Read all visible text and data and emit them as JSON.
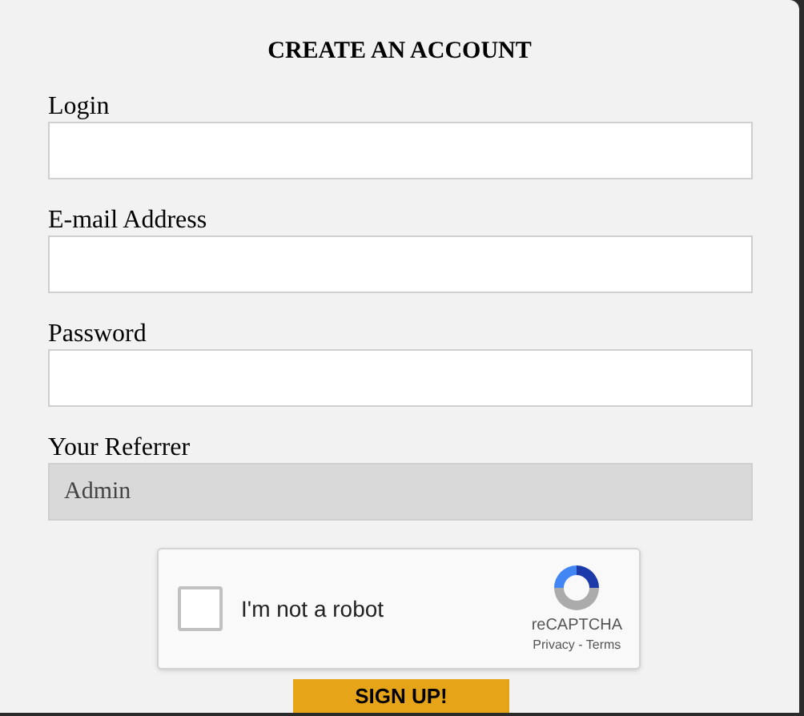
{
  "title": "CREATE AN ACCOUNT",
  "fields": [
    {
      "label": "Login",
      "disabled": false
    },
    {
      "label": "E-mail Address",
      "disabled": false
    },
    {
      "label": "Password",
      "disabled": false
    },
    {
      "label": "Your Referrer",
      "value": "Admin",
      "disabled": true
    }
  ],
  "captcha": {
    "label": "I'm not a robot",
    "checked": false,
    "brand": "reCAPTCHA",
    "footer": "Privacy - Terms"
  },
  "button": "SIGN UP!"
}
